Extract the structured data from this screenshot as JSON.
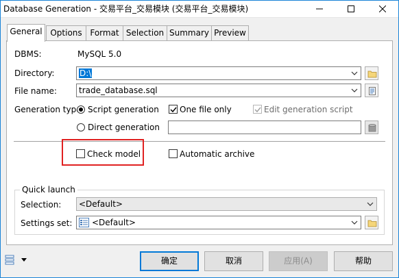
{
  "window": {
    "title": "Database Generation - 交易平台_交易模块 (交易平台_交易模块)",
    "minimize": "—",
    "maximize": "☐",
    "close": "✕"
  },
  "tabs": [
    {
      "label": "General",
      "active": true
    },
    {
      "label": "Options",
      "active": false
    },
    {
      "label": "Format",
      "active": false
    },
    {
      "label": "Selection",
      "active": false
    },
    {
      "label": "Summary",
      "active": false
    },
    {
      "label": "Preview",
      "active": false
    }
  ],
  "general": {
    "dbms_label": "DBMS:",
    "dbms_value": "MySQL 5.0",
    "directory_label": "Directory:",
    "directory_value": "D:\\",
    "filename_label": "File name:",
    "filename_value": "trade_database.sql",
    "generation_type_label": "Generation type:",
    "script_generation": {
      "label": "Script generation",
      "selected": true
    },
    "direct_generation": {
      "label": "Direct generation",
      "selected": false
    },
    "one_file_only": {
      "label": "One file only",
      "checked": true
    },
    "edit_generation_script": {
      "label": "Edit generation script",
      "checked": true,
      "disabled": true
    },
    "direct_generation_field": "",
    "check_model": {
      "label": "Check model",
      "checked": false
    },
    "automatic_archive": {
      "label": "Automatic archive",
      "checked": false
    }
  },
  "quick_launch": {
    "title": "Quick launch",
    "selection_label": "Selection:",
    "selection_value": "<Default>",
    "settings_set_label": "Settings set:",
    "settings_set_value": "<Default>"
  },
  "footer": {
    "ok": "确定",
    "cancel": "取消",
    "apply": "应用(A)",
    "help": "帮助"
  },
  "colors": {
    "accent": "#0078d7",
    "highlight_box": "#e02020",
    "window_border": "#1883d7"
  }
}
